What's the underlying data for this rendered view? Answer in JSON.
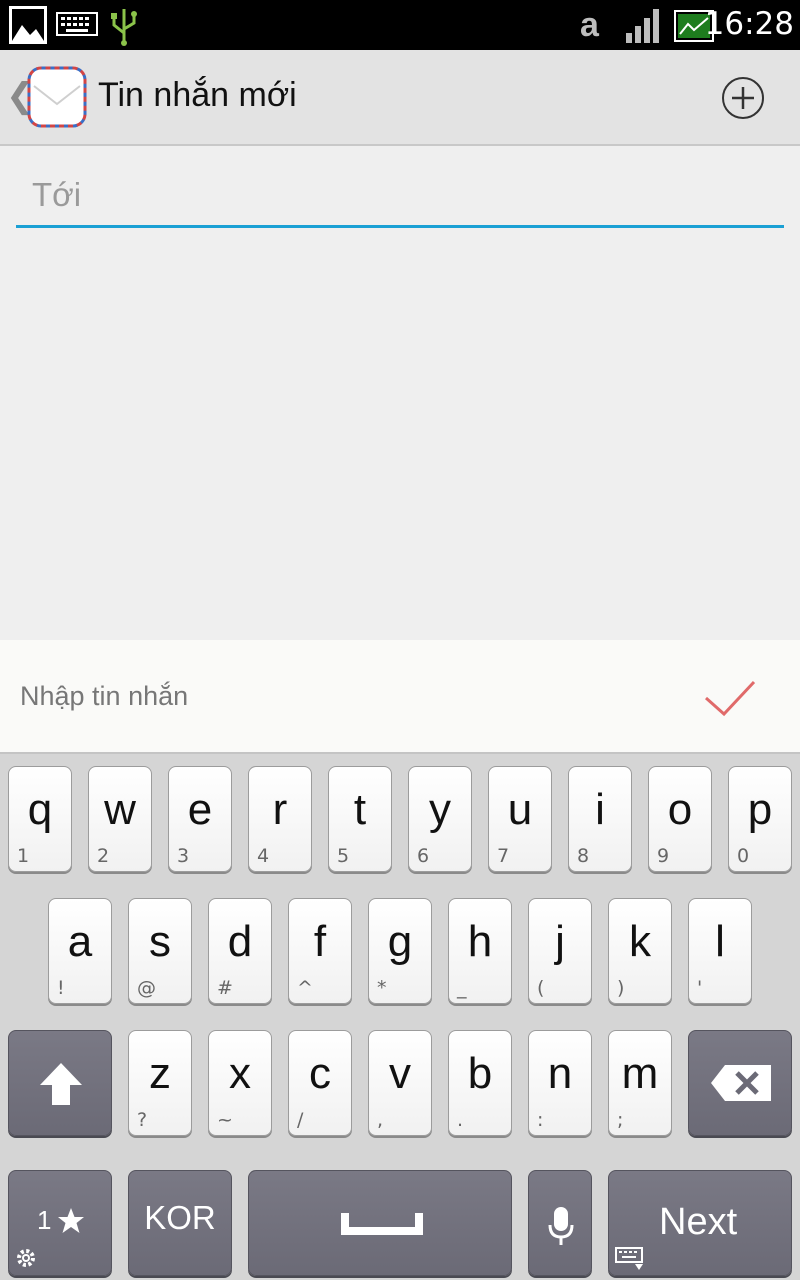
{
  "status_bar": {
    "time": "16:28",
    "icons": [
      "image-notification-icon",
      "keyboard-notification-icon",
      "usb-icon",
      "amazon-a-icon",
      "signal-bars-icon",
      "battery-icon"
    ]
  },
  "action_bar": {
    "title": "Tin nhắn mới",
    "back_glyph": "❮"
  },
  "recipient": {
    "placeholder": "Tới",
    "value": ""
  },
  "compose": {
    "placeholder": "Nhập tin nhắn",
    "value": ""
  },
  "keyboard": {
    "rows": [
      [
        {
          "main": "q",
          "sub": "1"
        },
        {
          "main": "w",
          "sub": "2"
        },
        {
          "main": "e",
          "sub": "3"
        },
        {
          "main": "r",
          "sub": "4"
        },
        {
          "main": "t",
          "sub": "5"
        },
        {
          "main": "y",
          "sub": "6"
        },
        {
          "main": "u",
          "sub": "7"
        },
        {
          "main": "i",
          "sub": "8"
        },
        {
          "main": "o",
          "sub": "9"
        },
        {
          "main": "p",
          "sub": "0"
        }
      ],
      [
        {
          "main": "a",
          "sub": "!"
        },
        {
          "main": "s",
          "sub": "@"
        },
        {
          "main": "d",
          "sub": "#"
        },
        {
          "main": "f",
          "sub": "^"
        },
        {
          "main": "g",
          "sub": "*"
        },
        {
          "main": "h",
          "sub": "_"
        },
        {
          "main": "j",
          "sub": "("
        },
        {
          "main": "k",
          "sub": ")"
        },
        {
          "main": "l",
          "sub": "'"
        }
      ],
      [
        {
          "main": "z",
          "sub": "?"
        },
        {
          "main": "x",
          "sub": "~"
        },
        {
          "main": "c",
          "sub": "/"
        },
        {
          "main": "v",
          "sub": ","
        },
        {
          "main": "b",
          "sub": "."
        },
        {
          "main": "n",
          "sub": ":"
        },
        {
          "main": "m",
          "sub": ";"
        }
      ]
    ],
    "symbols_label": "1",
    "language_label": "KOR",
    "next_label": "Next"
  },
  "colors": {
    "accent_underline": "#1ba0d4",
    "send_check": "#e06a6a",
    "dark_key": "#6f6e7a"
  }
}
